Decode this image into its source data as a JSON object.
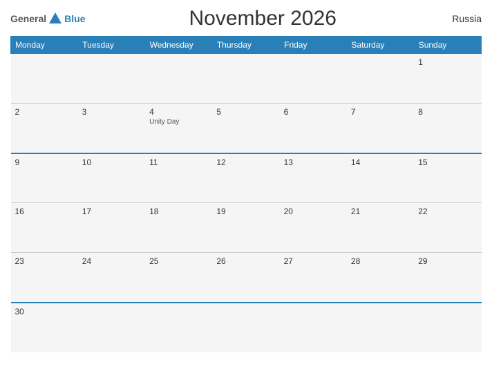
{
  "header": {
    "logo_general": "General",
    "logo_blue": "Blue",
    "title": "November 2026",
    "country": "Russia"
  },
  "weekdays": [
    "Monday",
    "Tuesday",
    "Wednesday",
    "Thursday",
    "Friday",
    "Saturday",
    "Sunday"
  ],
  "weeks": [
    {
      "blue_top": false,
      "days": [
        {
          "num": "",
          "holiday": ""
        },
        {
          "num": "",
          "holiday": ""
        },
        {
          "num": "",
          "holiday": ""
        },
        {
          "num": "",
          "holiday": ""
        },
        {
          "num": "",
          "holiday": ""
        },
        {
          "num": "",
          "holiday": ""
        },
        {
          "num": "1",
          "holiday": ""
        }
      ]
    },
    {
      "blue_top": false,
      "days": [
        {
          "num": "2",
          "holiday": ""
        },
        {
          "num": "3",
          "holiday": ""
        },
        {
          "num": "4",
          "holiday": "Unity Day"
        },
        {
          "num": "5",
          "holiday": ""
        },
        {
          "num": "6",
          "holiday": ""
        },
        {
          "num": "7",
          "holiday": ""
        },
        {
          "num": "8",
          "holiday": ""
        }
      ]
    },
    {
      "blue_top": true,
      "days": [
        {
          "num": "9",
          "holiday": ""
        },
        {
          "num": "10",
          "holiday": ""
        },
        {
          "num": "11",
          "holiday": ""
        },
        {
          "num": "12",
          "holiday": ""
        },
        {
          "num": "13",
          "holiday": ""
        },
        {
          "num": "14",
          "holiday": ""
        },
        {
          "num": "15",
          "holiday": ""
        }
      ]
    },
    {
      "blue_top": false,
      "days": [
        {
          "num": "16",
          "holiday": ""
        },
        {
          "num": "17",
          "holiday": ""
        },
        {
          "num": "18",
          "holiday": ""
        },
        {
          "num": "19",
          "holiday": ""
        },
        {
          "num": "20",
          "holiday": ""
        },
        {
          "num": "21",
          "holiday": ""
        },
        {
          "num": "22",
          "holiday": ""
        }
      ]
    },
    {
      "blue_top": false,
      "days": [
        {
          "num": "23",
          "holiday": ""
        },
        {
          "num": "24",
          "holiday": ""
        },
        {
          "num": "25",
          "holiday": ""
        },
        {
          "num": "26",
          "holiday": ""
        },
        {
          "num": "27",
          "holiday": ""
        },
        {
          "num": "28",
          "holiday": ""
        },
        {
          "num": "29",
          "holiday": ""
        }
      ]
    },
    {
      "blue_top": true,
      "last": true,
      "days": [
        {
          "num": "30",
          "holiday": ""
        },
        {
          "num": "",
          "holiday": ""
        },
        {
          "num": "",
          "holiday": ""
        },
        {
          "num": "",
          "holiday": ""
        },
        {
          "num": "",
          "holiday": ""
        },
        {
          "num": "",
          "holiday": ""
        },
        {
          "num": "",
          "holiday": ""
        }
      ]
    }
  ]
}
